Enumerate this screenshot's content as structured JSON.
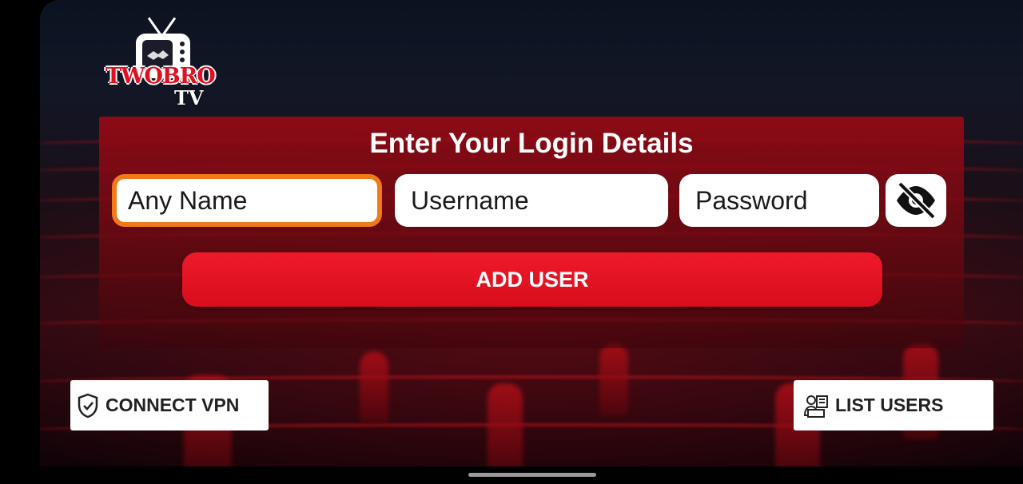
{
  "app": {
    "logo_text": "TWOBRO",
    "logo_subtext": "TV"
  },
  "login_panel": {
    "title": "Enter Your Login Details",
    "any_name_placeholder": "Any Name",
    "username_placeholder": "Username",
    "password_placeholder": "Password",
    "toggle_password_icon": "eye-off-icon",
    "add_user_label": "ADD USER"
  },
  "footer": {
    "connect_vpn_label": "CONNECT VPN",
    "connect_vpn_icon": "shield-check-icon",
    "list_users_label": "LIST USERS",
    "list_users_icon": "user-list-icon"
  },
  "colors": {
    "accent_red": "#e21424",
    "focus_orange": "#f07a1a",
    "panel_red": "#960a14"
  }
}
